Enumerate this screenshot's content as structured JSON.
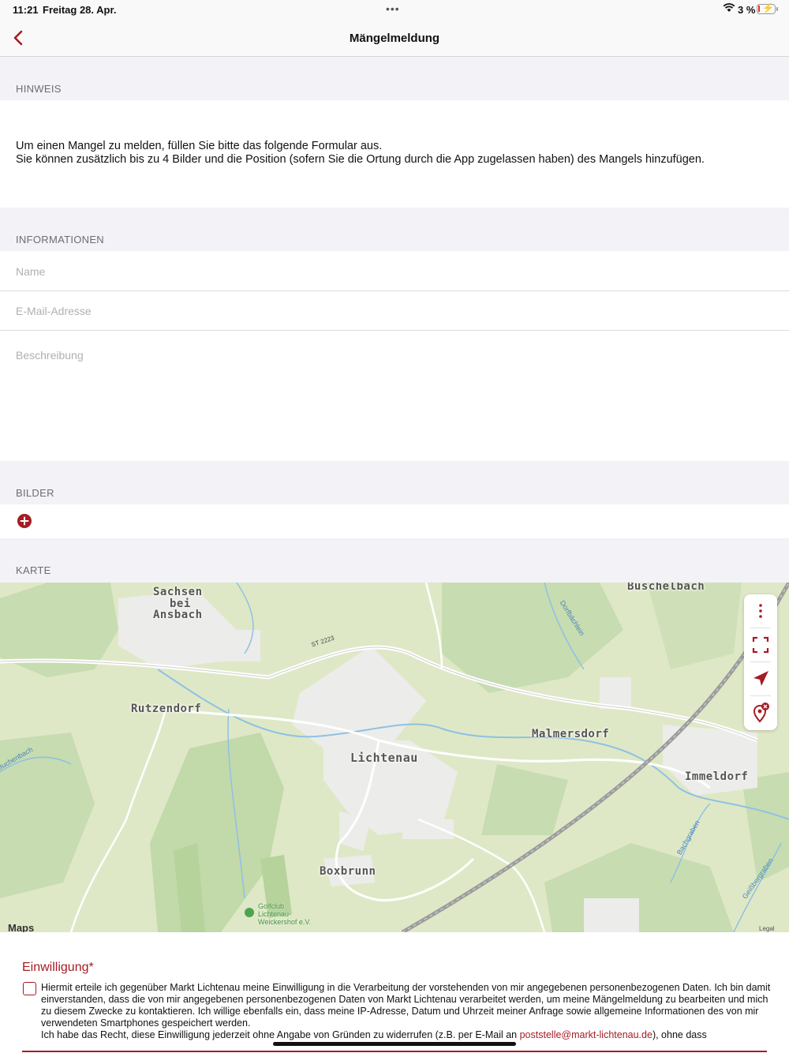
{
  "status": {
    "time": "11:21",
    "date": "Freitag 28. Apr.",
    "dots": "•••",
    "battery": "3 %",
    "charging_icon": "bolt-icon"
  },
  "nav": {
    "title": "Mängelmeldung",
    "back_icon": "chevron-left-icon"
  },
  "sections": {
    "hint": "HINWEIS",
    "info": "INFORMATIONEN",
    "images": "BILDER",
    "map": "KARTE"
  },
  "hint": {
    "line1": "Um einen Mangel zu melden, füllen Sie bitte das folgende Formular aus.",
    "line2": "Sie können zusätzlich bis zu 4 Bilder und die Position (sofern Sie die Ortung durch die App zugelassen haben) des Mangels hinzufügen."
  },
  "form": {
    "name_placeholder": "Name",
    "email_placeholder": "E-Mail-Adresse",
    "description_placeholder": "Beschreibung"
  },
  "map": {
    "places": {
      "sachsen": "Sachsen",
      "bei": "bei",
      "ansbach": "Ansbach",
      "buschelbach": "Buschelbach",
      "rutzendorf": "Rutzendorf",
      "malmersdorf": "Malmersdorf",
      "lichtenau": "Lichtenau",
      "immeldorf": "Immeldorf",
      "boxbrunn": "Boxbrunn"
    },
    "streams": {
      "dorfbaechlein": "Dorfbächlein",
      "buchenbach": "Buchenbach",
      "bachgraben": "Bachgraben",
      "geissbergraben": "Geißbergraben"
    },
    "road": "ST 2223",
    "golf": [
      "Golfclub",
      "Lichtenau-",
      "Weickershof e.V."
    ],
    "logo": "Maps",
    "legal": "Legal",
    "accent_color": "#a51c24"
  },
  "consent": {
    "title": "Einwilligung*",
    "text_1": "Hiermit erteile ich gegenüber Markt Lichtenau meine Einwilligung in die Verarbeitung der vorstehenden von mir angegebenen personenbezogenen Daten. Ich bin damit einverstanden, dass die von mir angegebenen personenbezogenen Daten von Markt Lichtenau verarbeitet werden, um meine Mängelmeldung zu bearbeiten und mich zu diesem Zwecke zu kontaktieren. Ich willige ebenfalls ein, dass meine IP-Adresse, Datum und Uhrzeit meiner Anfrage sowie allgemeine Informationen des von mir verwendeten Smartphones gespeichert werden.",
    "text_2": "Ich habe das Recht, diese Einwilligung jederzeit ohne Angabe von Gründen zu widerrufen (z.B. per E-Mail an ",
    "email": "poststelle@markt-lichtenau.de",
    "text_3": "), ohne dass"
  }
}
